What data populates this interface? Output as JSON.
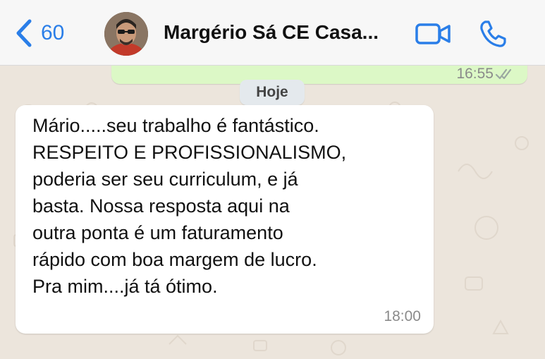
{
  "header": {
    "back_count": "60",
    "contact_name": "Margério Sá CE Casa...",
    "accent_color": "#2a7ee8",
    "icons": {
      "back": "chevron-left-icon",
      "video": "video-camera-icon",
      "call": "phone-icon"
    }
  },
  "chat": {
    "outgoing_message": {
      "time": "16:55",
      "status": "read"
    },
    "date_divider": "Hoje",
    "incoming_message": {
      "lines": [
        "Mário.....seu trabalho é fantástico.",
        "RESPEITO E PROFISSIONALISMO,",
        "poderia ser seu curriculum,  e já",
        "basta. Nossa resposta aqui na",
        "outra ponta é um faturamento",
        "rápido com boa margem de lucro.",
        "Pra mim....já tá ótimo."
      ],
      "time": "18:00"
    },
    "colors": {
      "outgoing_bubble": "#dcf8c6",
      "incoming_bubble": "#ffffff",
      "background": "#ece5dc"
    }
  }
}
